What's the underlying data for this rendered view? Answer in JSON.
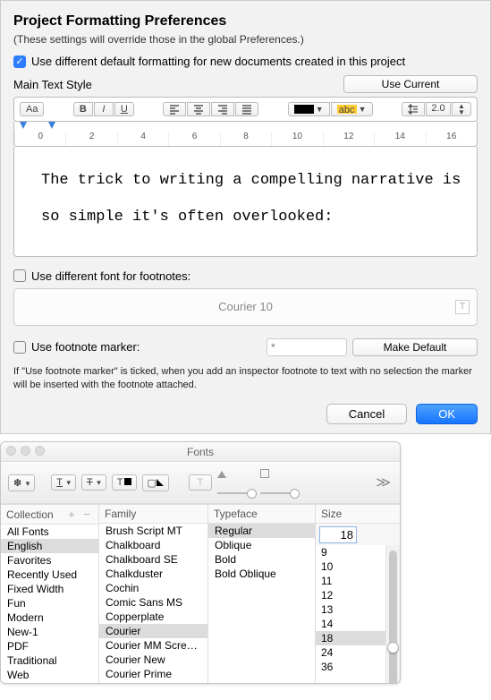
{
  "prefs": {
    "title": "Project Formatting Preferences",
    "subtitle": "(These settings will override those in the global Preferences.)",
    "use_diff_format": {
      "label": "Use different default formatting for new documents created in this project",
      "checked": true
    },
    "main_text_style_label": "Main Text Style",
    "use_current_btn": "Use Current",
    "toolbar": {
      "case_label": "Aa",
      "bold": "B",
      "italic": "I",
      "underline": "U",
      "line_spacing": "2.0"
    },
    "ruler_numbers": [
      "0",
      "2",
      "4",
      "6",
      "8",
      "10",
      "12",
      "14",
      "16"
    ],
    "sample_text": "The trick to writing a compelling narrative is so simple it's often overlooked:",
    "use_diff_footnote": {
      "label": "Use different font for footnotes:",
      "checked": false
    },
    "footnote_preview": "Courier 10",
    "use_marker": {
      "label": "Use footnote marker:",
      "checked": false
    },
    "marker_placeholder": "*",
    "make_default_btn": "Make Default",
    "help": "If \"Use footnote marker\" is ticked, when you add an inspector footnote to text with no selection the marker will be inserted with the footnote attached.",
    "cancel": "Cancel",
    "ok": "OK"
  },
  "fonts": {
    "title": "Fonts",
    "headers": {
      "collection": "Collection",
      "family": "Family",
      "typeface": "Typeface",
      "size": "Size"
    },
    "collections": [
      "All Fonts",
      "English",
      "Favorites",
      "Recently Used",
      "Fixed Width",
      "Fun",
      "Modern",
      "New-1",
      "PDF",
      "Traditional",
      "Web"
    ],
    "collection_selected": "English",
    "families": [
      "Brush Script MT",
      "Chalkboard",
      "Chalkboard SE",
      "Chalkduster",
      "Cochin",
      "Comic Sans MS",
      "Copperplate",
      "Courier",
      "Courier MM Screenwriter",
      "Courier New",
      "Courier Prime"
    ],
    "family_selected": "Courier",
    "typefaces": [
      "Regular",
      "Oblique",
      "Bold",
      "Bold Oblique"
    ],
    "typeface_selected": "Regular",
    "sizes": [
      "9",
      "10",
      "11",
      "12",
      "13",
      "14",
      "18",
      "24",
      "36"
    ],
    "size_selected": "18",
    "size_input": "18"
  }
}
